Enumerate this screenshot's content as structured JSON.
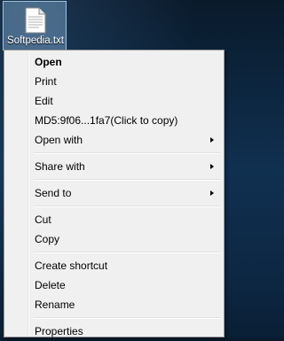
{
  "desktop": {
    "file_label": "Softpedia.txt"
  },
  "context_menu": {
    "groups": [
      [
        {
          "label": "Open",
          "bold": true,
          "submenu": false
        },
        {
          "label": "Print",
          "bold": false,
          "submenu": false
        },
        {
          "label": "Edit",
          "bold": false,
          "submenu": false
        },
        {
          "label": "MD5:9f06...1fa7(Click to copy)",
          "bold": false,
          "submenu": false
        },
        {
          "label": "Open with",
          "bold": false,
          "submenu": true
        }
      ],
      [
        {
          "label": "Share with",
          "bold": false,
          "submenu": true
        }
      ],
      [
        {
          "label": "Send to",
          "bold": false,
          "submenu": true
        }
      ],
      [
        {
          "label": "Cut",
          "bold": false,
          "submenu": false
        },
        {
          "label": "Copy",
          "bold": false,
          "submenu": false
        }
      ],
      [
        {
          "label": "Create shortcut",
          "bold": false,
          "submenu": false
        },
        {
          "label": "Delete",
          "bold": false,
          "submenu": false
        },
        {
          "label": "Rename",
          "bold": false,
          "submenu": false
        }
      ],
      [
        {
          "label": "Properties",
          "bold": false,
          "submenu": false
        }
      ]
    ]
  },
  "colors": {
    "menu_background": "#f0f0f0",
    "menu_border": "#979797",
    "selection_highlight": "#99c6f0"
  }
}
